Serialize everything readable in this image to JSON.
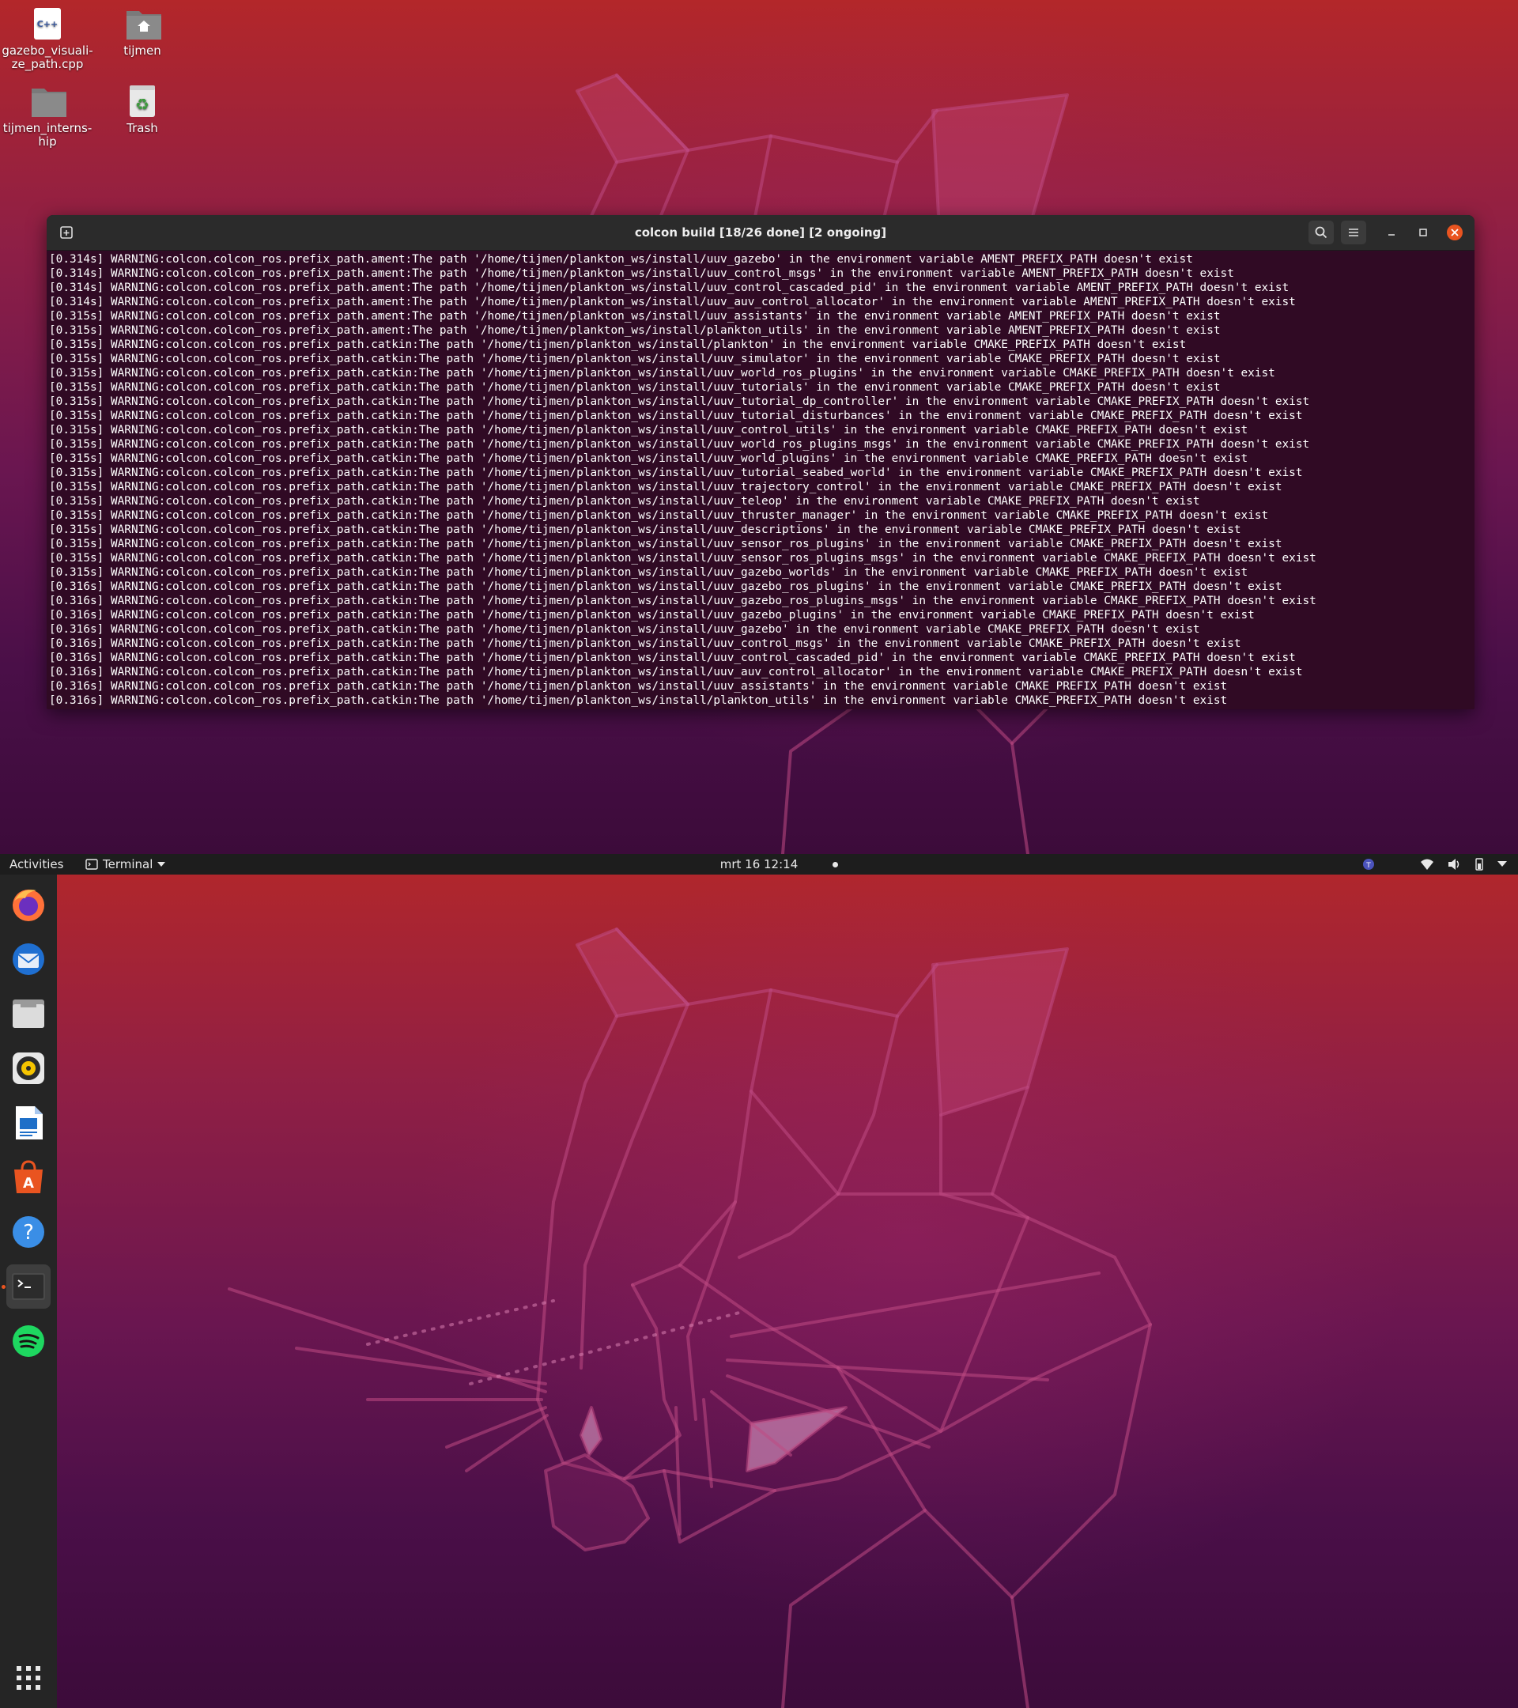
{
  "desktop_icons": [
    {
      "name": "gazebo_visualize_path.cpp",
      "line1": "gazebo_visuali-",
      "line2": "ze_path.cpp",
      "badge": "C++",
      "icon": "cpp-file-icon"
    },
    {
      "name": "tijmen",
      "line1": "tijmen",
      "line2": "",
      "icon": "home-folder-icon"
    },
    {
      "name": "tijmen_internship",
      "line1": "tijmen_interns-",
      "line2": "hip",
      "icon": "folder-icon"
    },
    {
      "name": "Trash",
      "line1": "Trash",
      "line2": "",
      "icon": "trash-icon"
    }
  ],
  "terminal": {
    "title": "colcon build [18/26 done] [2 ongoing]",
    "lines": [
      "[0.314s] WARNING:colcon.colcon_ros.prefix_path.ament:The path '/home/tijmen/plankton_ws/install/uuv_gazebo' in the environment variable AMENT_PREFIX_PATH doesn't exist",
      "[0.314s] WARNING:colcon.colcon_ros.prefix_path.ament:The path '/home/tijmen/plankton_ws/install/uuv_control_msgs' in the environment variable AMENT_PREFIX_PATH doesn't exist",
      "[0.314s] WARNING:colcon.colcon_ros.prefix_path.ament:The path '/home/tijmen/plankton_ws/install/uuv_control_cascaded_pid' in the environment variable AMENT_PREFIX_PATH doesn't exist",
      "[0.314s] WARNING:colcon.colcon_ros.prefix_path.ament:The path '/home/tijmen/plankton_ws/install/uuv_auv_control_allocator' in the environment variable AMENT_PREFIX_PATH doesn't exist",
      "[0.315s] WARNING:colcon.colcon_ros.prefix_path.ament:The path '/home/tijmen/plankton_ws/install/uuv_assistants' in the environment variable AMENT_PREFIX_PATH doesn't exist",
      "[0.315s] WARNING:colcon.colcon_ros.prefix_path.ament:The path '/home/tijmen/plankton_ws/install/plankton_utils' in the environment variable AMENT_PREFIX_PATH doesn't exist",
      "[0.315s] WARNING:colcon.colcon_ros.prefix_path.catkin:The path '/home/tijmen/plankton_ws/install/plankton' in the environment variable CMAKE_PREFIX_PATH doesn't exist",
      "[0.315s] WARNING:colcon.colcon_ros.prefix_path.catkin:The path '/home/tijmen/plankton_ws/install/uuv_simulator' in the environment variable CMAKE_PREFIX_PATH doesn't exist",
      "[0.315s] WARNING:colcon.colcon_ros.prefix_path.catkin:The path '/home/tijmen/plankton_ws/install/uuv_world_ros_plugins' in the environment variable CMAKE_PREFIX_PATH doesn't exist",
      "[0.315s] WARNING:colcon.colcon_ros.prefix_path.catkin:The path '/home/tijmen/plankton_ws/install/uuv_tutorials' in the environment variable CMAKE_PREFIX_PATH doesn't exist",
      "[0.315s] WARNING:colcon.colcon_ros.prefix_path.catkin:The path '/home/tijmen/plankton_ws/install/uuv_tutorial_dp_controller' in the environment variable CMAKE_PREFIX_PATH doesn't exist",
      "[0.315s] WARNING:colcon.colcon_ros.prefix_path.catkin:The path '/home/tijmen/plankton_ws/install/uuv_tutorial_disturbances' in the environment variable CMAKE_PREFIX_PATH doesn't exist",
      "[0.315s] WARNING:colcon.colcon_ros.prefix_path.catkin:The path '/home/tijmen/plankton_ws/install/uuv_control_utils' in the environment variable CMAKE_PREFIX_PATH doesn't exist",
      "[0.315s] WARNING:colcon.colcon_ros.prefix_path.catkin:The path '/home/tijmen/plankton_ws/install/uuv_world_ros_plugins_msgs' in the environment variable CMAKE_PREFIX_PATH doesn't exist",
      "[0.315s] WARNING:colcon.colcon_ros.prefix_path.catkin:The path '/home/tijmen/plankton_ws/install/uuv_world_plugins' in the environment variable CMAKE_PREFIX_PATH doesn't exist",
      "[0.315s] WARNING:colcon.colcon_ros.prefix_path.catkin:The path '/home/tijmen/plankton_ws/install/uuv_tutorial_seabed_world' in the environment variable CMAKE_PREFIX_PATH doesn't exist",
      "[0.315s] WARNING:colcon.colcon_ros.prefix_path.catkin:The path '/home/tijmen/plankton_ws/install/uuv_trajectory_control' in the environment variable CMAKE_PREFIX_PATH doesn't exist",
      "[0.315s] WARNING:colcon.colcon_ros.prefix_path.catkin:The path '/home/tijmen/plankton_ws/install/uuv_teleop' in the environment variable CMAKE_PREFIX_PATH doesn't exist",
      "[0.315s] WARNING:colcon.colcon_ros.prefix_path.catkin:The path '/home/tijmen/plankton_ws/install/uuv_thruster_manager' in the environment variable CMAKE_PREFIX_PATH doesn't exist",
      "[0.315s] WARNING:colcon.colcon_ros.prefix_path.catkin:The path '/home/tijmen/plankton_ws/install/uuv_descriptions' in the environment variable CMAKE_PREFIX_PATH doesn't exist",
      "[0.315s] WARNING:colcon.colcon_ros.prefix_path.catkin:The path '/home/tijmen/plankton_ws/install/uuv_sensor_ros_plugins' in the environment variable CMAKE_PREFIX_PATH doesn't exist",
      "[0.315s] WARNING:colcon.colcon_ros.prefix_path.catkin:The path '/home/tijmen/plankton_ws/install/uuv_sensor_ros_plugins_msgs' in the environment variable CMAKE_PREFIX_PATH doesn't exist",
      "[0.315s] WARNING:colcon.colcon_ros.prefix_path.catkin:The path '/home/tijmen/plankton_ws/install/uuv_gazebo_worlds' in the environment variable CMAKE_PREFIX_PATH doesn't exist",
      "[0.316s] WARNING:colcon.colcon_ros.prefix_path.catkin:The path '/home/tijmen/plankton_ws/install/uuv_gazebo_ros_plugins' in the environment variable CMAKE_PREFIX_PATH doesn't exist",
      "[0.316s] WARNING:colcon.colcon_ros.prefix_path.catkin:The path '/home/tijmen/plankton_ws/install/uuv_gazebo_ros_plugins_msgs' in the environment variable CMAKE_PREFIX_PATH doesn't exist",
      "[0.316s] WARNING:colcon.colcon_ros.prefix_path.catkin:The path '/home/tijmen/plankton_ws/install/uuv_gazebo_plugins' in the environment variable CMAKE_PREFIX_PATH doesn't exist",
      "[0.316s] WARNING:colcon.colcon_ros.prefix_path.catkin:The path '/home/tijmen/plankton_ws/install/uuv_gazebo' in the environment variable CMAKE_PREFIX_PATH doesn't exist",
      "[0.316s] WARNING:colcon.colcon_ros.prefix_path.catkin:The path '/home/tijmen/plankton_ws/install/uuv_control_msgs' in the environment variable CMAKE_PREFIX_PATH doesn't exist",
      "[0.316s] WARNING:colcon.colcon_ros.prefix_path.catkin:The path '/home/tijmen/plankton_ws/install/uuv_control_cascaded_pid' in the environment variable CMAKE_PREFIX_PATH doesn't exist",
      "[0.316s] WARNING:colcon.colcon_ros.prefix_path.catkin:The path '/home/tijmen/plankton_ws/install/uuv_auv_control_allocator' in the environment variable CMAKE_PREFIX_PATH doesn't exist",
      "[0.316s] WARNING:colcon.colcon_ros.prefix_path.catkin:The path '/home/tijmen/plankton_ws/install/uuv_assistants' in the environment variable CMAKE_PREFIX_PATH doesn't exist",
      "[0.316s] WARNING:colcon.colcon_ros.prefix_path.catkin:The path '/home/tijmen/plankton_ws/install/plankton_utils' in the environment variable CMAKE_PREFIX_PATH doesn't exist"
    ]
  },
  "top_bar": {
    "activities": "Activities",
    "app_menu": "Terminal",
    "clock": "mrt 16  12:14"
  },
  "dock": {
    "items": [
      {
        "name": "Firefox",
        "icon": "firefox-icon"
      },
      {
        "name": "Thunderbird",
        "icon": "thunderbird-icon"
      },
      {
        "name": "Files",
        "icon": "files-icon"
      },
      {
        "name": "Rhythmbox",
        "icon": "rhythmbox-icon"
      },
      {
        "name": "LibreOffice Writer",
        "icon": "writer-icon"
      },
      {
        "name": "Ubuntu Software",
        "icon": "software-icon"
      },
      {
        "name": "Help",
        "icon": "help-icon"
      },
      {
        "name": "Terminal",
        "icon": "terminal-icon",
        "active": true
      },
      {
        "name": "Spotify",
        "icon": "spotify-icon"
      },
      {
        "name": "Show Applications",
        "icon": "app-grid-icon"
      }
    ]
  },
  "colors": {
    "terminal_bg": "#300a24",
    "header_bg": "#2b2b2b",
    "close_button": "#e95420",
    "top_bar_bg": "#1d1d1d",
    "dock_bg": "#252525"
  }
}
